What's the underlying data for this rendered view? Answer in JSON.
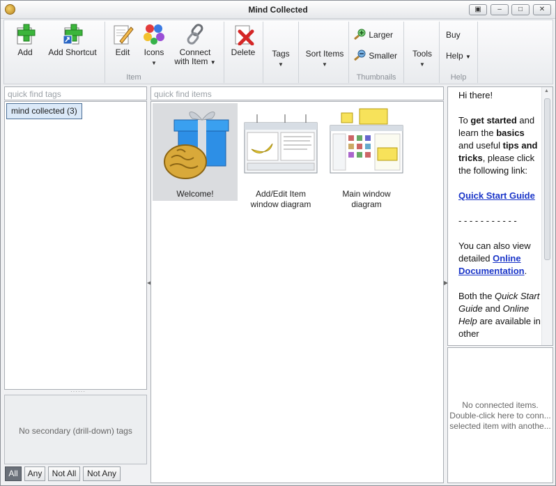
{
  "window": {
    "title": "Mind Collected"
  },
  "ribbon": {
    "add": "Add",
    "add_shortcut": "Add Shortcut",
    "edit": "Edit",
    "icons": "Icons",
    "connect_line1": "Connect",
    "connect_line2": "with Item",
    "delete": "Delete",
    "tags": "Tags",
    "sort_items": "Sort Items",
    "larger": "Larger",
    "smaller": "Smaller",
    "tools": "Tools",
    "buy": "Buy",
    "help": "Help",
    "group_item": "Item",
    "group_thumbnails": "Thumbnails",
    "group_help": "Help"
  },
  "tags_pane": {
    "find_placeholder": "quick find tags",
    "tag": "mind collected (3)",
    "secondary_text": "No secondary (drill-down) tags",
    "filters": [
      "All",
      "Any",
      "Not All",
      "Not Any"
    ]
  },
  "items_pane": {
    "find_placeholder": "quick find items",
    "items": [
      {
        "line1": "Welcome!",
        "line2": ""
      },
      {
        "line1": "Add/Edit Item",
        "line2": "window diagram"
      },
      {
        "line1": "Main window",
        "line2": "diagram"
      }
    ]
  },
  "help_pane": {
    "p1": "Hi there!",
    "p2a": "To ",
    "p2b": "get started",
    "p2c": " and learn the ",
    "p2d": "basics",
    "p2e": " and useful ",
    "p2f": "tips and tricks",
    "p2g": ", please click the following link:",
    "link1": "Quick Start Guide",
    "dashes": "- - - - - - - - - - -",
    "p4a": "You can also view detailed ",
    "link2": "Online Documentation",
    "p4b": ".",
    "p5a": "Both the ",
    "p5b": "Quick Start Guide",
    "p5c": " and ",
    "p5d": "Online Help",
    "p5e": " are available in other"
  },
  "connected_pane": {
    "line1": "No connected items.",
    "line2": "Double-click here to conn...",
    "line3": "selected item with anothe..."
  },
  "colors": {
    "accent": "#1a35c8",
    "selection": "#dbe9f8"
  }
}
